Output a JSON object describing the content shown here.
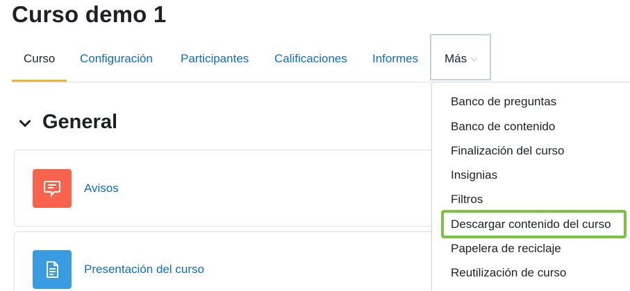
{
  "page": {
    "title": "Curso demo 1"
  },
  "tabs": [
    {
      "label": "Curso"
    },
    {
      "label": "Configuración"
    },
    {
      "label": "Participantes"
    },
    {
      "label": "Calificaciones"
    },
    {
      "label": "Informes"
    },
    {
      "label": "Más"
    }
  ],
  "section": {
    "title": "General"
  },
  "activities": [
    {
      "name": "Avisos",
      "icon": "forum-icon"
    },
    {
      "name": "Presentación del curso",
      "icon": "page-icon"
    }
  ],
  "more_menu": {
    "items": [
      {
        "label": "Banco de preguntas"
      },
      {
        "label": "Banco de contenido"
      },
      {
        "label": "Finalización del curso"
      },
      {
        "label": "Insignias"
      },
      {
        "label": "Filtros"
      },
      {
        "label": "Descargar contenido del curso",
        "highlighted": true
      },
      {
        "label": "Papelera de reciclaje"
      },
      {
        "label": "Reutilización de curso"
      }
    ]
  },
  "colors": {
    "link": "#0f6cbf",
    "active_tab_underline": "#f0b43c",
    "highlight_border": "#7cc242",
    "forum_icon_bg": "#f7634d",
    "page_icon_bg": "#399be2"
  }
}
